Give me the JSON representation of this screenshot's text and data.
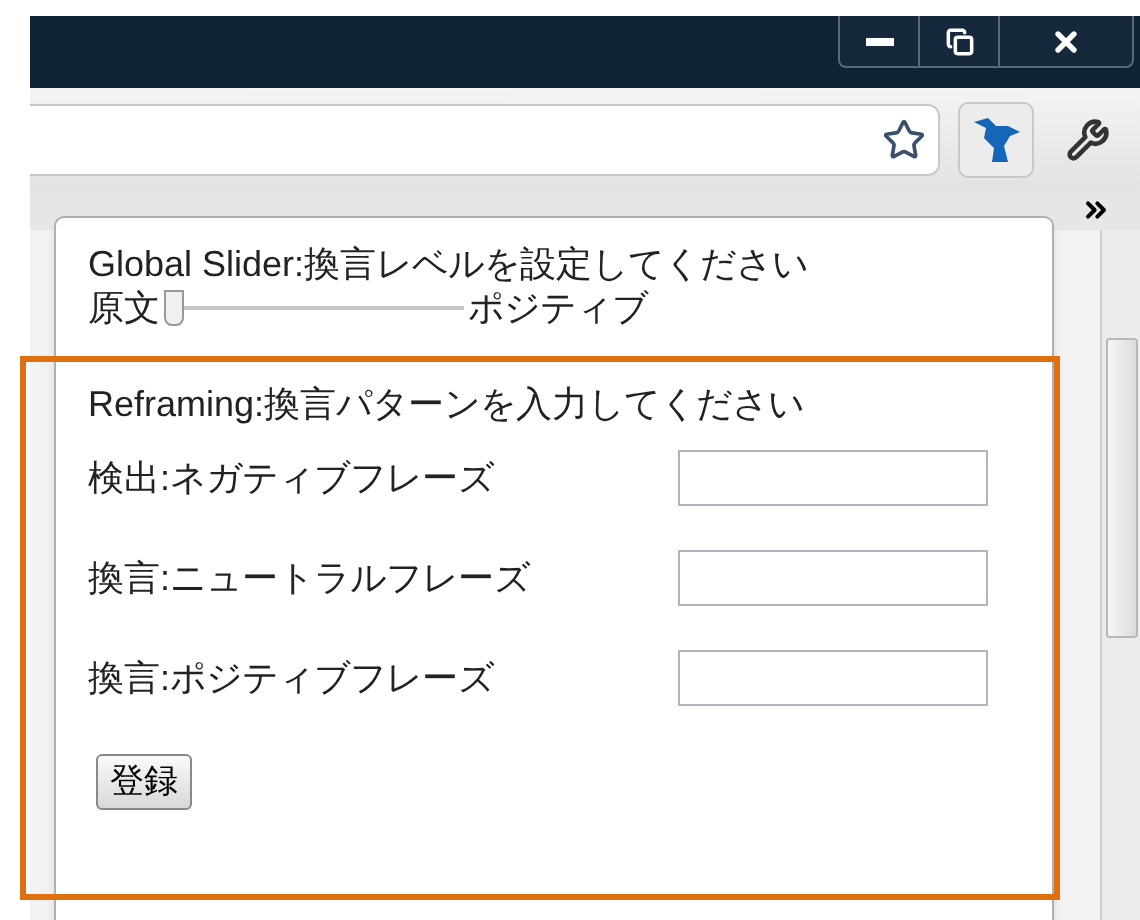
{
  "popup": {
    "global_slider": {
      "title": "Global Slider:換言レベルを設定してください",
      "left_label": "原文",
      "right_label": "ポジティブ",
      "level": 0
    },
    "reframing": {
      "title": "Reframing:換言パターンを入力してください",
      "rows": [
        {
          "label": "検出:ネガティブフレーズ"
        },
        {
          "label": "換言:ニュートラルフレーズ"
        },
        {
          "label": "換言:ポジティブフレーズ"
        }
      ],
      "button": "登録"
    }
  }
}
